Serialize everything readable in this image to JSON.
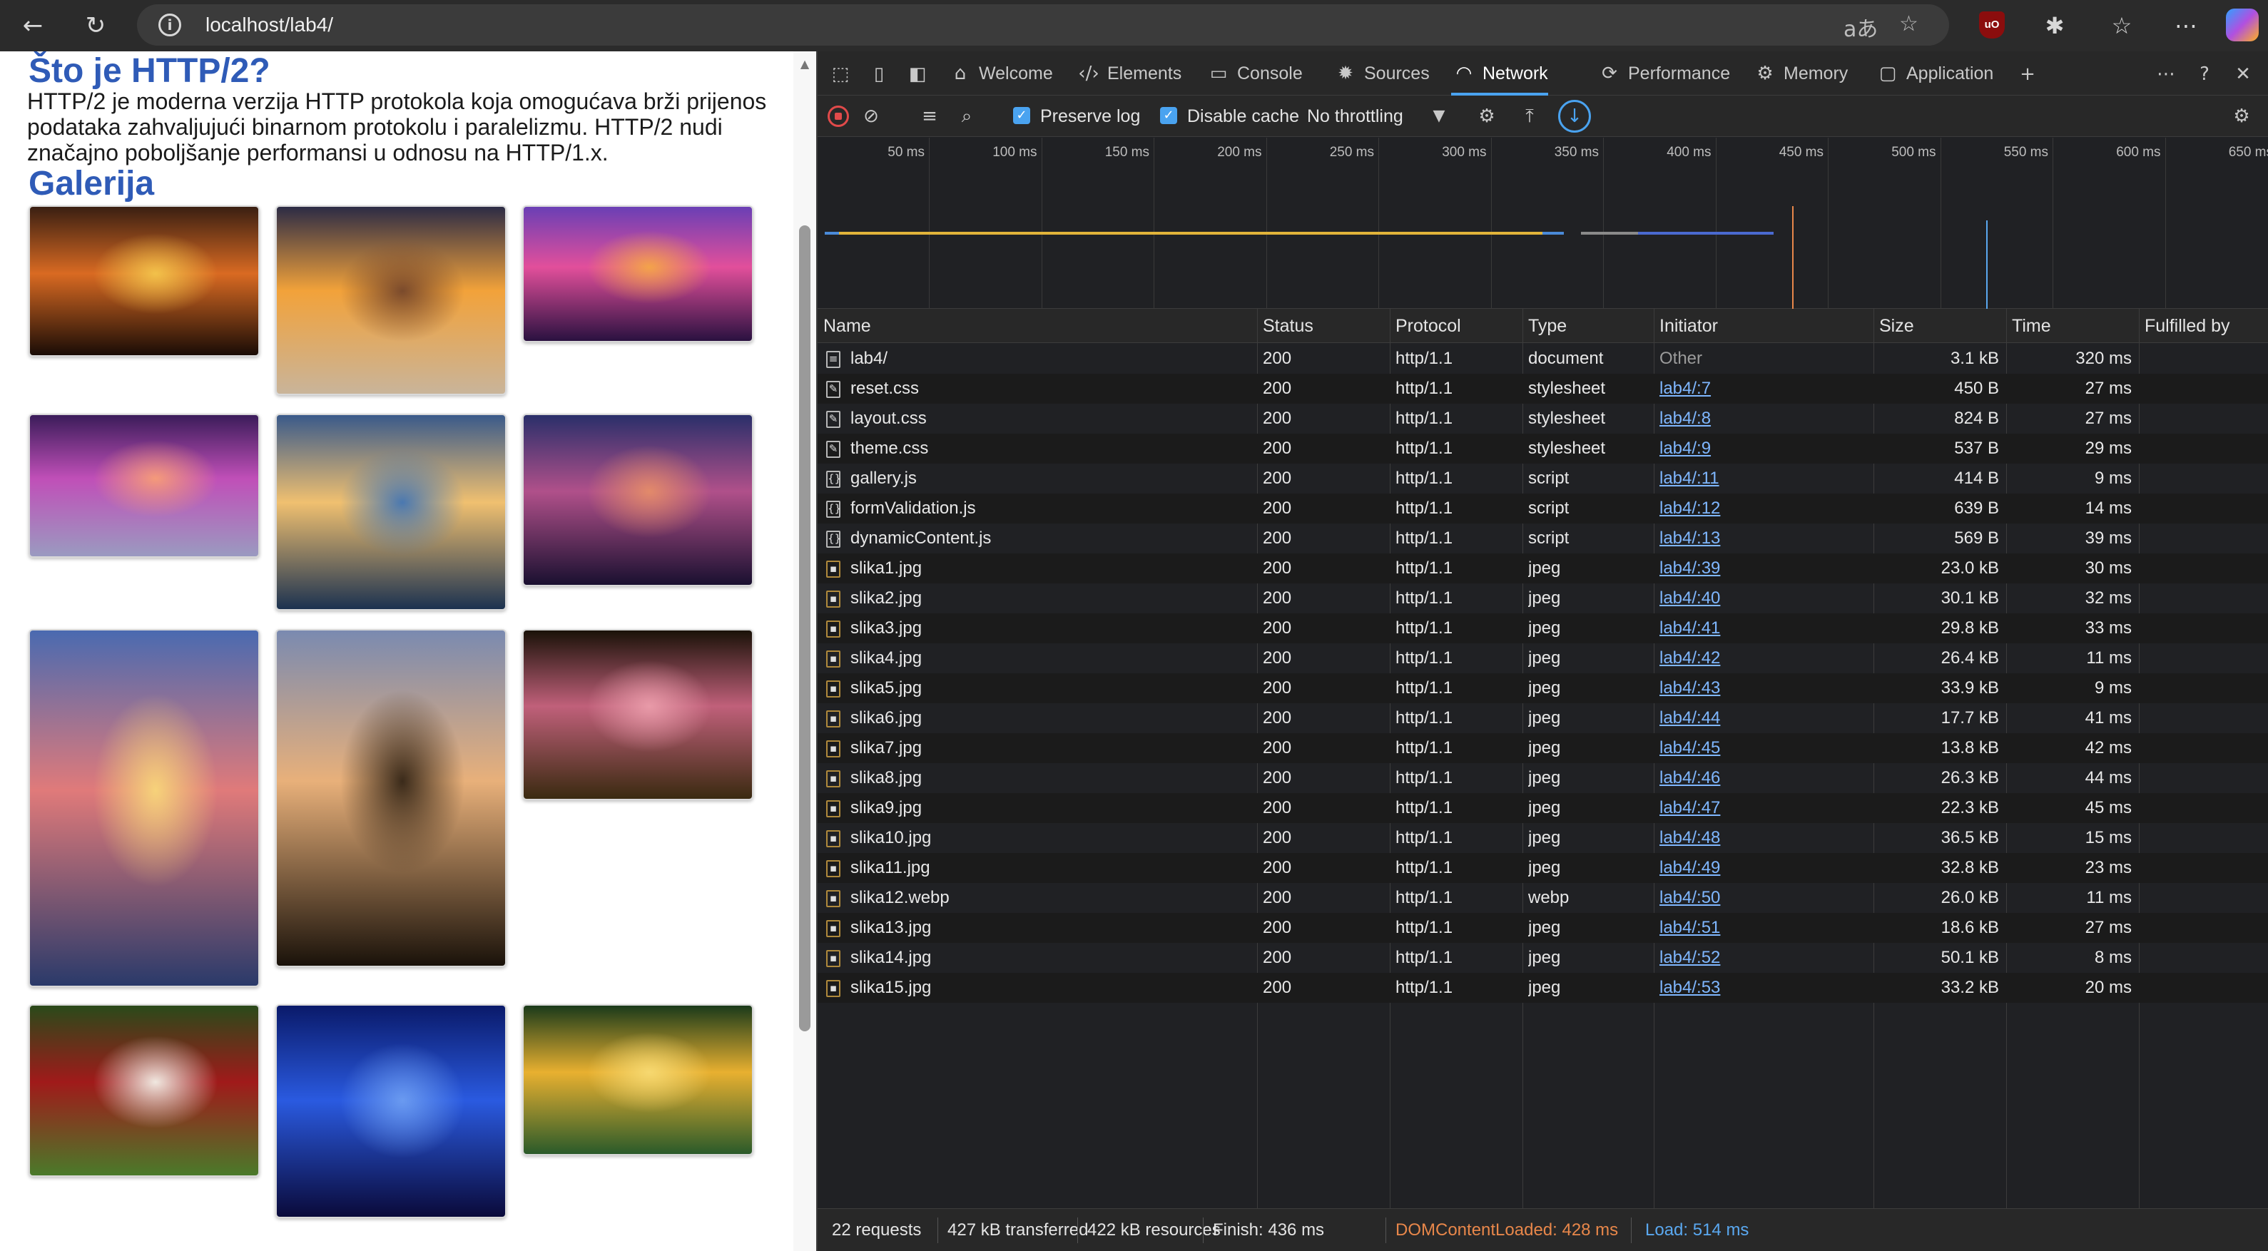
{
  "browser": {
    "url": "localhost/lab4/",
    "read_aloud_glyph": "aあ"
  },
  "page": {
    "heading_http2": "Što je HTTP/2?",
    "intro_text": "HTTP/2 je moderna verzija HTTP protokola koja omogućava brži prijenos podataka zahvaljujući binarnom protokolu i paralelizmu. HTTP/2 nudi značajno poboljšanje performansi u odnosu na HTTP/1.x.",
    "heading_gallery": "Galerija",
    "gallery": [
      {
        "name": "gallery-image-sunset-hills",
        "colors": [
          "#3a1f12",
          "#d96a22",
          "#f2c14a",
          "#1a0c06"
        ]
      },
      {
        "name": "gallery-image-sunset-beach-waves",
        "colors": [
          "#2c2b45",
          "#f2a23a",
          "#7a4a2c",
          "#c9b49a"
        ]
      },
      {
        "name": "gallery-image-purple-tree-sunset",
        "colors": [
          "#6a3fb5",
          "#e24f9b",
          "#f3a34a",
          "#2a1140"
        ]
      },
      {
        "name": "gallery-image-purple-beach",
        "colors": [
          "#3b1c5a",
          "#c04fb8",
          "#f49a7a",
          "#9a9ac0"
        ]
      },
      {
        "name": "gallery-image-ocean-sunset",
        "colors": [
          "#3a5a8a",
          "#f0c070",
          "#4a78b0",
          "#1c3250"
        ]
      },
      {
        "name": "gallery-image-palm-sunset",
        "colors": [
          "#2a2f6a",
          "#b0508a",
          "#e28a6a",
          "#1a1030"
        ]
      },
      {
        "name": "gallery-image-sun-over-sea",
        "colors": [
          "#4a6ab0",
          "#e07a7a",
          "#f6d27a",
          "#2a3a6a"
        ]
      },
      {
        "name": "gallery-image-tree-silhouette",
        "colors": [
          "#7a8ab0",
          "#e8b07a",
          "#3a2a1a",
          "#1a120a"
        ]
      },
      {
        "name": "gallery-image-pink-rose",
        "colors": [
          "#1a1208",
          "#c0607a",
          "#e89aa8",
          "#3a2a10"
        ]
      },
      {
        "name": "gallery-image-rose-bouquet",
        "colors": [
          "#2a4a1a",
          "#a01a1a",
          "#f0e8e0",
          "#4a7a2a"
        ]
      },
      {
        "name": "gallery-image-blue-rose",
        "colors": [
          "#0a1a6a",
          "#2a5ae0",
          "#6a9af0",
          "#0a0a3a"
        ]
      },
      {
        "name": "gallery-image-yellow-rose",
        "colors": [
          "#1a3a1a",
          "#e8b030",
          "#f6d870",
          "#2a5a2a"
        ]
      }
    ]
  },
  "devtools": {
    "tabs": [
      {
        "label": "Welcome",
        "icon": "home-icon",
        "glyph": "⌂"
      },
      {
        "label": "Elements",
        "icon": "code-icon",
        "glyph": "‹/›"
      },
      {
        "label": "Console",
        "icon": "console-icon",
        "glyph": "▭"
      },
      {
        "label": "Sources",
        "icon": "bug-icon",
        "glyph": "✹"
      },
      {
        "label": "Network",
        "icon": "wifi-icon",
        "glyph": "◠"
      },
      {
        "label": "Performance",
        "icon": "performance-icon",
        "glyph": "⟳"
      },
      {
        "label": "Memory",
        "icon": "memory-icon",
        "glyph": "⚙"
      },
      {
        "label": "Application",
        "icon": "application-icon",
        "glyph": "▢"
      }
    ],
    "active_tab": "Network",
    "toolbar": {
      "preserve_log": "Preserve log",
      "disable_cache": "Disable cache",
      "throttling": "No throttling"
    },
    "overview_ticks": [
      "50 ms",
      "100 ms",
      "150 ms",
      "200 ms",
      "250 ms",
      "300 ms",
      "350 ms",
      "400 ms",
      "450 ms",
      "500 ms",
      "550 ms",
      "600 ms",
      "650 ms"
    ],
    "columns": [
      "Name",
      "Status",
      "Protocol",
      "Type",
      "Initiator",
      "Size",
      "Time",
      "Fulfilled by"
    ],
    "requests": [
      {
        "name": "lab4/",
        "status": "200",
        "protocol": "http/1.1",
        "type": "document",
        "initiator": "Other",
        "size": "3.1 kB",
        "time": "320 ms"
      },
      {
        "name": "reset.css",
        "status": "200",
        "protocol": "http/1.1",
        "type": "stylesheet",
        "initiator": "lab4/:7",
        "size": "450 B",
        "time": "27 ms"
      },
      {
        "name": "layout.css",
        "status": "200",
        "protocol": "http/1.1",
        "type": "stylesheet",
        "initiator": "lab4/:8",
        "size": "824 B",
        "time": "27 ms"
      },
      {
        "name": "theme.css",
        "status": "200",
        "protocol": "http/1.1",
        "type": "stylesheet",
        "initiator": "lab4/:9",
        "size": "537 B",
        "time": "29 ms"
      },
      {
        "name": "gallery.js",
        "status": "200",
        "protocol": "http/1.1",
        "type": "script",
        "initiator": "lab4/:11",
        "size": "414 B",
        "time": "9 ms"
      },
      {
        "name": "formValidation.js",
        "status": "200",
        "protocol": "http/1.1",
        "type": "script",
        "initiator": "lab4/:12",
        "size": "639 B",
        "time": "14 ms"
      },
      {
        "name": "dynamicContent.js",
        "status": "200",
        "protocol": "http/1.1",
        "type": "script",
        "initiator": "lab4/:13",
        "size": "569 B",
        "time": "39 ms"
      },
      {
        "name": "slika1.jpg",
        "status": "200",
        "protocol": "http/1.1",
        "type": "jpeg",
        "initiator": "lab4/:39",
        "size": "23.0 kB",
        "time": "30 ms"
      },
      {
        "name": "slika2.jpg",
        "status": "200",
        "protocol": "http/1.1",
        "type": "jpeg",
        "initiator": "lab4/:40",
        "size": "30.1 kB",
        "time": "32 ms"
      },
      {
        "name": "slika3.jpg",
        "status": "200",
        "protocol": "http/1.1",
        "type": "jpeg",
        "initiator": "lab4/:41",
        "size": "29.8 kB",
        "time": "33 ms"
      },
      {
        "name": "slika4.jpg",
        "status": "200",
        "protocol": "http/1.1",
        "type": "jpeg",
        "initiator": "lab4/:42",
        "size": "26.4 kB",
        "time": "11 ms"
      },
      {
        "name": "slika5.jpg",
        "status": "200",
        "protocol": "http/1.1",
        "type": "jpeg",
        "initiator": "lab4/:43",
        "size": "33.9 kB",
        "time": "9 ms"
      },
      {
        "name": "slika6.jpg",
        "status": "200",
        "protocol": "http/1.1",
        "type": "jpeg",
        "initiator": "lab4/:44",
        "size": "17.7 kB",
        "time": "41 ms"
      },
      {
        "name": "slika7.jpg",
        "status": "200",
        "protocol": "http/1.1",
        "type": "jpeg",
        "initiator": "lab4/:45",
        "size": "13.8 kB",
        "time": "42 ms"
      },
      {
        "name": "slika8.jpg",
        "status": "200",
        "protocol": "http/1.1",
        "type": "jpeg",
        "initiator": "lab4/:46",
        "size": "26.3 kB",
        "time": "44 ms"
      },
      {
        "name": "slika9.jpg",
        "status": "200",
        "protocol": "http/1.1",
        "type": "jpeg",
        "initiator": "lab4/:47",
        "size": "22.3 kB",
        "time": "45 ms"
      },
      {
        "name": "slika10.jpg",
        "status": "200",
        "protocol": "http/1.1",
        "type": "jpeg",
        "initiator": "lab4/:48",
        "size": "36.5 kB",
        "time": "15 ms"
      },
      {
        "name": "slika11.jpg",
        "status": "200",
        "protocol": "http/1.1",
        "type": "jpeg",
        "initiator": "lab4/:49",
        "size": "32.8 kB",
        "time": "23 ms"
      },
      {
        "name": "slika12.webp",
        "status": "200",
        "protocol": "http/1.1",
        "type": "webp",
        "initiator": "lab4/:50",
        "size": "26.0 kB",
        "time": "11 ms"
      },
      {
        "name": "slika13.jpg",
        "status": "200",
        "protocol": "http/1.1",
        "type": "jpeg",
        "initiator": "lab4/:51",
        "size": "18.6 kB",
        "time": "27 ms"
      },
      {
        "name": "slika14.jpg",
        "status": "200",
        "protocol": "http/1.1",
        "type": "jpeg",
        "initiator": "lab4/:52",
        "size": "50.1 kB",
        "time": "8 ms"
      },
      {
        "name": "slika15.jpg",
        "status": "200",
        "protocol": "http/1.1",
        "type": "jpeg",
        "initiator": "lab4/:53",
        "size": "33.2 kB",
        "time": "20 ms"
      }
    ],
    "status_bar": {
      "requests": "22 requests",
      "transferred": "427 kB transferred",
      "resources": "422 kB resources",
      "finish": "Finish: 436 ms",
      "dom_content_loaded": "DOMContentLoaded: 428 ms",
      "load": "Load: 514 ms"
    },
    "colors": {
      "accent": "#4aa3f0",
      "dom_content_loaded": "#e8874a",
      "load": "#5aa8f0",
      "link": "#7fb7ff"
    }
  }
}
